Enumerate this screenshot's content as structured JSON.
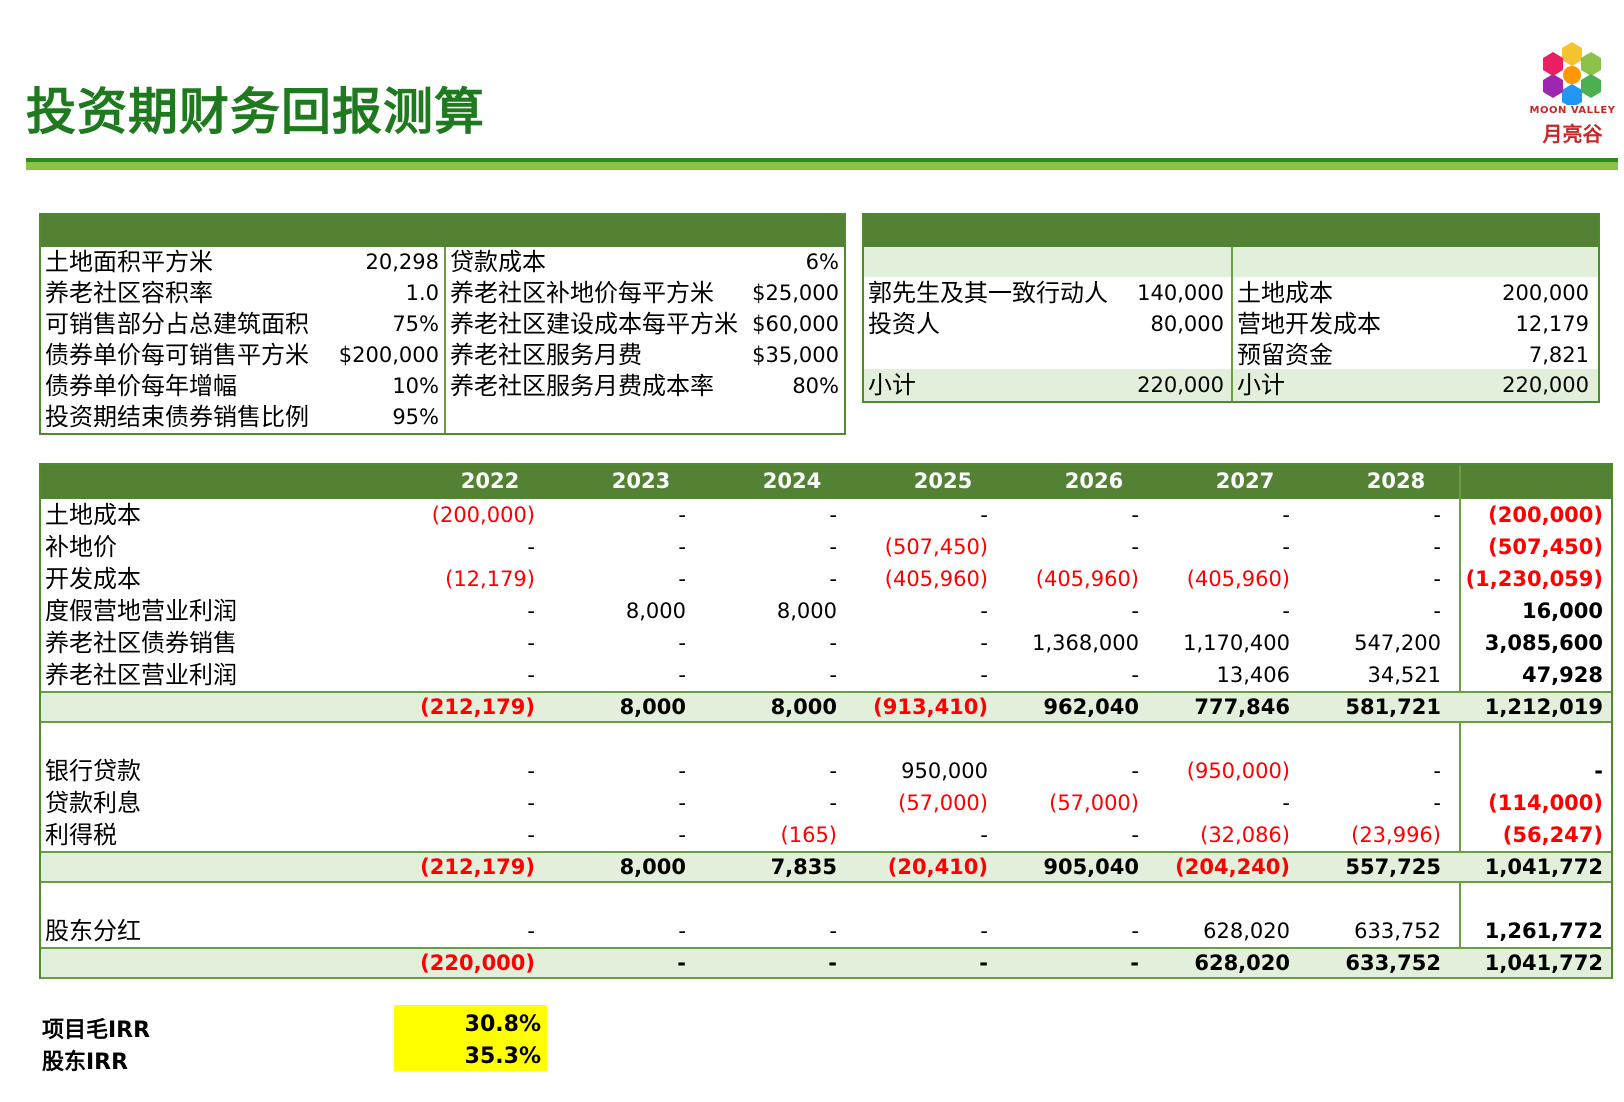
{
  "title": "投资期财务回报测算",
  "logo": {
    "en": "MOON VALLEY",
    "cn": "月亮谷"
  },
  "params_left": [
    {
      "label": "土地面积平方米",
      "value": "20,298"
    },
    {
      "label": "养老社区容积率",
      "value": "1.0"
    },
    {
      "label": "可销售部分占总建筑面积",
      "value": "75%"
    },
    {
      "label": "债券单价每可销售平方米",
      "value": "$200,000"
    },
    {
      "label": "债券单价每年增幅",
      "value": "10%"
    },
    {
      "label": "投资期结束债券销售比例",
      "value": "95%"
    }
  ],
  "params_mid": [
    {
      "label": "贷款成本",
      "value": "6%"
    },
    {
      "label": "养老社区补地价每平方米",
      "value": "$25,000"
    },
    {
      "label": "养老社区建设成本每平方米",
      "value": "$60,000"
    },
    {
      "label": "养老社区服务月费",
      "value": "$35,000"
    },
    {
      "label": "养老社区服务月费成本率",
      "value": "80%"
    }
  ],
  "investors": [
    {
      "label": "郭先生及其一致行动人",
      "value": "140,000"
    },
    {
      "label": "投资人",
      "value": "80,000"
    },
    {
      "label": "小计",
      "value": "220,000"
    }
  ],
  "uses": [
    {
      "label": "土地成本",
      "value": "200,000"
    },
    {
      "label": "营地开发成本",
      "value": "12,179"
    },
    {
      "label": "预留资金",
      "value": "7,821"
    },
    {
      "label": "小计",
      "value": "220,000"
    }
  ],
  "years": [
    "2022",
    "2023",
    "2024",
    "2025",
    "2026",
    "2027",
    "2028"
  ],
  "rows1": [
    {
      "label": "土地成本",
      "cells": [
        "(200,000)",
        "-",
        "-",
        "-",
        "-",
        "-",
        "-"
      ],
      "total": "(200,000)"
    },
    {
      "label": "补地价",
      "cells": [
        "-",
        "-",
        "-",
        "(507,450)",
        "-",
        "-",
        "-"
      ],
      "total": "(507,450)"
    },
    {
      "label": "开发成本",
      "cells": [
        "(12,179)",
        "-",
        "-",
        "(405,960)",
        "(405,960)",
        "(405,960)",
        "-"
      ],
      "total": "(1,230,059)"
    },
    {
      "label": "度假营地营业利润",
      "cells": [
        "-",
        "8,000",
        "8,000",
        "-",
        "-",
        "-",
        "-"
      ],
      "total": "16,000"
    },
    {
      "label": "养老社区债券销售",
      "cells": [
        "-",
        "-",
        "-",
        "-",
        "1,368,000",
        "1,170,400",
        "547,200"
      ],
      "total": "3,085,600"
    },
    {
      "label": "养老社区营业利润",
      "cells": [
        "-",
        "-",
        "-",
        "-",
        "-",
        "13,406",
        "34,521"
      ],
      "total": "47,928"
    }
  ],
  "sum1": {
    "cells": [
      "(212,179)",
      "8,000",
      "8,000",
      "(913,410)",
      "962,040",
      "777,846",
      "581,721"
    ],
    "total": "1,212,019"
  },
  "rows2": [
    {
      "label": "银行贷款",
      "cells": [
        "-",
        "-",
        "-",
        "950,000",
        "-",
        "(950,000)",
        "-"
      ],
      "total": "-"
    },
    {
      "label": "贷款利息",
      "cells": [
        "-",
        "-",
        "-",
        "(57,000)",
        "(57,000)",
        "-",
        "-"
      ],
      "total": "(114,000)"
    },
    {
      "label": "利得税",
      "cells": [
        "-",
        "-",
        "(165)",
        "-",
        "-",
        "(32,086)",
        "(23,996)"
      ],
      "total": "(56,247)"
    }
  ],
  "sum2": {
    "cells": [
      "(212,179)",
      "8,000",
      "7,835",
      "(20,410)",
      "905,040",
      "(204,240)",
      "557,725"
    ],
    "total": "1,041,772"
  },
  "rows3": [
    {
      "label": "股东分红",
      "cells": [
        "-",
        "-",
        "-",
        "-",
        "-",
        "628,020",
        "633,752"
      ],
      "total": "1,261,772"
    }
  ],
  "sum3": {
    "cells": [
      "(220,000)",
      "-",
      "-",
      "-",
      "-",
      "628,020",
      "633,752"
    ],
    "total": "1,041,772"
  },
  "irr": [
    {
      "label": "项目毛IRR",
      "value": "30.8%"
    },
    {
      "label": "股东IRR",
      "value": "35.3%"
    }
  ]
}
